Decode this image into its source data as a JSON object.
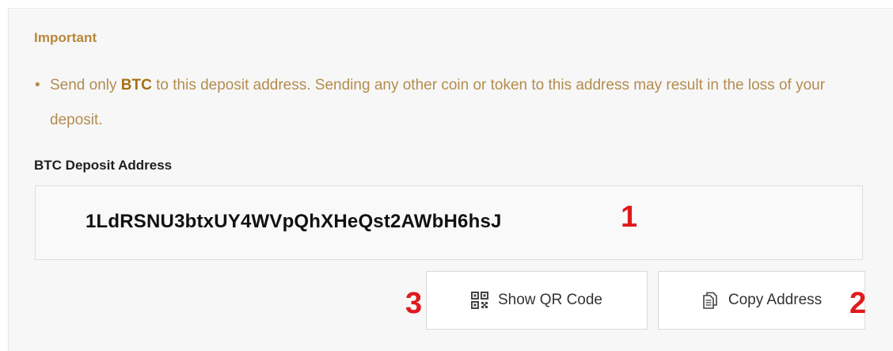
{
  "notice": {
    "title": "Important",
    "bullet": "•",
    "text_before": "Send only ",
    "coin": "BTC",
    "text_after": " to this deposit address. Sending any other coin or token to this address may result in the loss of your deposit."
  },
  "deposit": {
    "label": "BTC Deposit Address",
    "address": "1LdRSNU3btxUY4WVpQhXHeQst2AWbH6hsJ"
  },
  "buttons": {
    "show_qr": {
      "label": "Show QR Code",
      "icon": "qr-code-icon"
    },
    "copy_address": {
      "label": "Copy Address",
      "icon": "copy-icon"
    }
  },
  "annotations": {
    "marker_1": "1",
    "marker_2": "2",
    "marker_3": "3",
    "color": "#e0191d"
  },
  "colors": {
    "important_text": "#b7873a",
    "notice_text": "#b48c4e",
    "panel_background": "#f7f7f7"
  }
}
